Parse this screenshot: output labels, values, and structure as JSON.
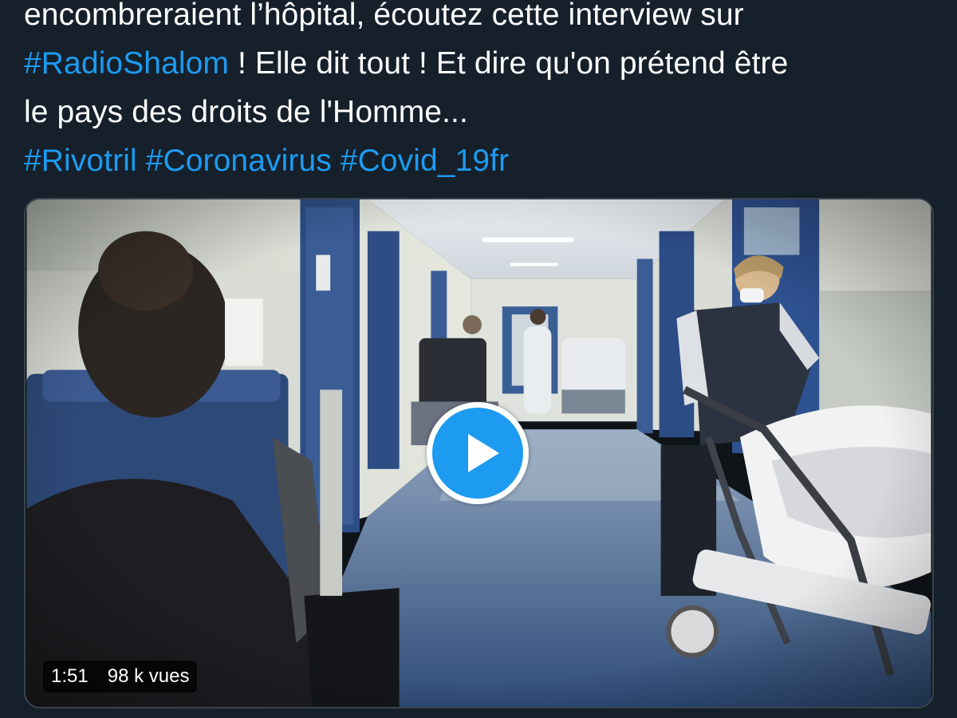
{
  "tweet": {
    "lines": [
      [
        {
          "text": "encombreraient l’hôpital, écoutez cette interview sur",
          "hashtag": false
        }
      ],
      [
        {
          "text": "#RadioShalom",
          "hashtag": true
        },
        {
          "text": " ! Elle dit tout ! Et dire qu'on prétend être",
          "hashtag": false
        }
      ],
      [
        {
          "text": "le pays des droits de l'Homme...",
          "hashtag": false
        }
      ],
      [
        {
          "text": "#Rivotril",
          "hashtag": true
        },
        {
          "text": " ",
          "hashtag": false
        },
        {
          "text": "#Coronavirus",
          "hashtag": true
        },
        {
          "text": " ",
          "hashtag": false
        },
        {
          "text": "#Covid_19fr",
          "hashtag": true
        }
      ]
    ]
  },
  "video": {
    "duration": "1:51",
    "views": "98 k vues",
    "play_icon": "play-icon"
  },
  "colors": {
    "background": "#15202b",
    "text": "#ffffff",
    "hashtag": "#1d9bf0",
    "play_button": "#1d9bf0",
    "card_border": "#38444d"
  }
}
